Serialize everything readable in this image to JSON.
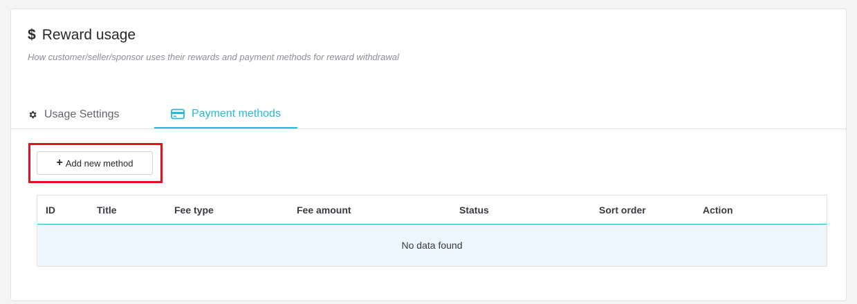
{
  "header": {
    "icon": "dollar-icon",
    "title": "Reward usage",
    "subtitle": "How customer/seller/sponsor uses their rewards and payment methods for reward withdrawal"
  },
  "tabs": [
    {
      "label": "Usage Settings",
      "icon": "gear-icon",
      "active": false
    },
    {
      "label": "Payment methods",
      "icon": "credit-card-icon",
      "active": true
    }
  ],
  "toolbar": {
    "add_button_label": "Add new method",
    "add_button_icon": "plus-icon"
  },
  "table": {
    "columns": [
      "ID",
      "Title",
      "Fee type",
      "Fee amount",
      "Status",
      "Sort order",
      "Action"
    ],
    "rows": [],
    "empty_message": "No data found"
  },
  "colors": {
    "accent": "#25b9d7",
    "highlight": "#e4101b",
    "empty_row_bg": "#eef6fb"
  }
}
